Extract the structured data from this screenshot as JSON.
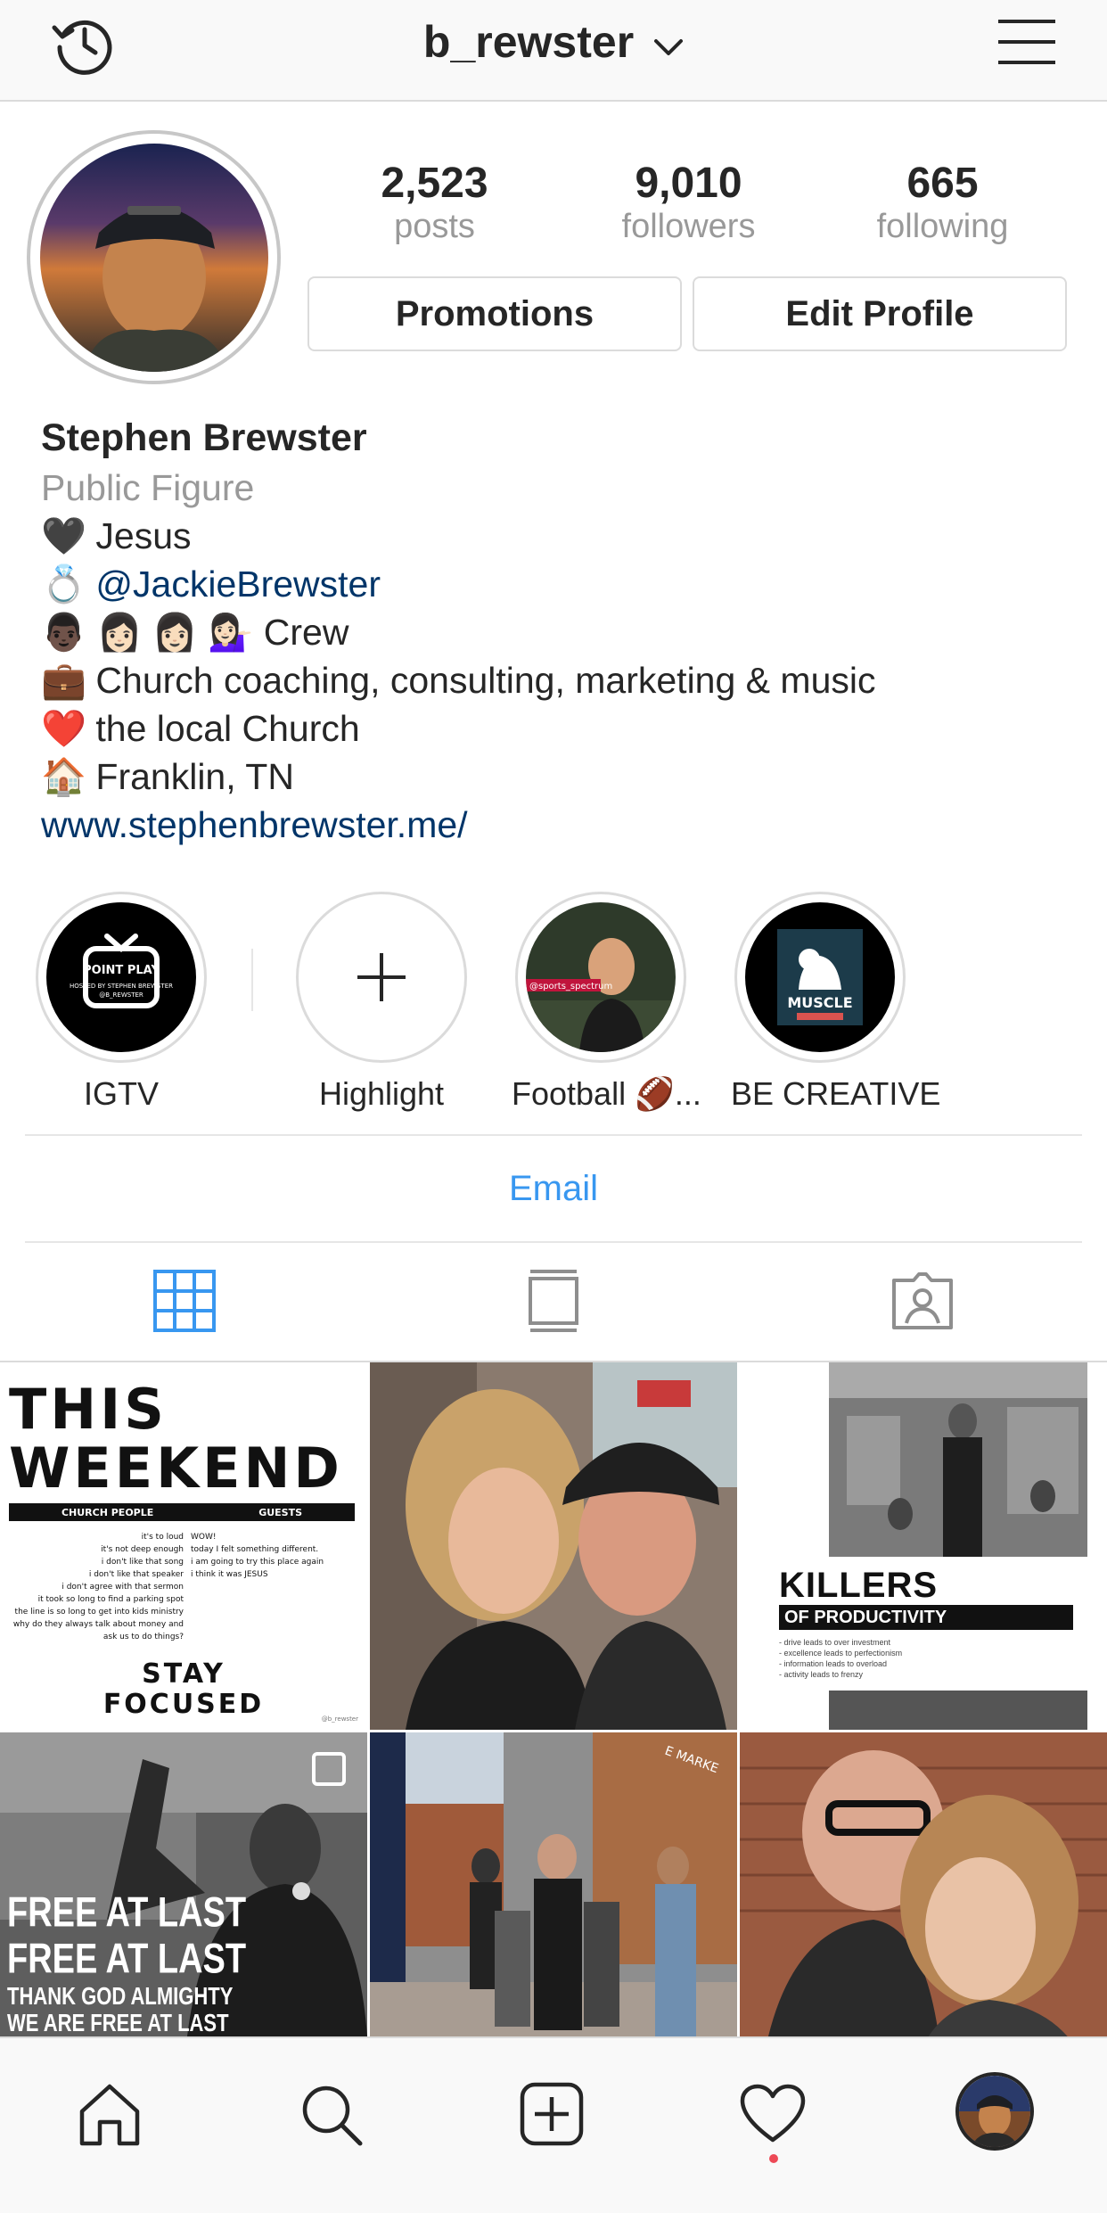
{
  "header": {
    "username": "b_rewster",
    "history_icon": "history-icon",
    "menu_icon": "hamburger-menu-icon"
  },
  "profile": {
    "stats": [
      {
        "value": "2,523",
        "label": "posts"
      },
      {
        "value": "9,010",
        "label": "followers"
      },
      {
        "value": "665",
        "label": "following"
      }
    ],
    "promotions_label": "Promotions",
    "edit_profile_label": "Edit Profile"
  },
  "bio": {
    "name": "Stephen  Brewster",
    "category": "Public Figure",
    "lines": [
      {
        "emoji": "🖤",
        "text": "Jesus"
      },
      {
        "emoji": "💍",
        "text": "@JackieBrewster"
      },
      {
        "emoji": "👨🏿 👩🏻 👩🏻 💁🏻‍♀️",
        "text": "Crew"
      },
      {
        "emoji": "💼",
        "text": "Church coaching, consulting, marketing & music"
      },
      {
        "emoji": "❤️",
        "text": "the local Church"
      },
      {
        "emoji": "🏠",
        "text": "Franklin, TN"
      }
    ],
    "website": "www.stephenbrewster.me/"
  },
  "highlights": [
    {
      "label": "IGTV",
      "cover_text": "POINT PLAY · HOSTED BY STEPHEN BREWSTER · @B_REWSTER"
    },
    {
      "label": "Highlight"
    },
    {
      "label": "Football 🏈...",
      "cover_text": "@sports_spectrum"
    },
    {
      "label": "BE CREATIVE",
      "cover_text": "MUSCLE"
    }
  ],
  "email_label": "Email",
  "tabs": [
    "grid-icon",
    "feed-list-icon",
    "tagged-icon"
  ],
  "posts": {
    "p1": {
      "line1": "THIS",
      "line2": "WEEKEND",
      "left_header": "CHURCH PEOPLE",
      "right_header": "GUESTS",
      "left_lines": [
        "it's to loud",
        "it's not deep enough",
        "i don't like that song",
        "i don't like that speaker",
        "i don't agree with that sermon",
        "it took so long to find a parking spot",
        "the line is so long to get into kids ministry",
        "why do they always talk about money and",
        "ask us to do things?"
      ],
      "right_lines": [
        "WOW!",
        "today I felt something different.",
        "i am going to try this place again",
        "i think it was JESUS"
      ],
      "footer1": "STAY",
      "footer2": "FOCUSED",
      "handle": "@b_rewster"
    },
    "p3": {
      "title": "KILLERS",
      "subtitle": "OF PRODUCTIVITY",
      "bullets": [
        "- drive leads to over investment",
        "- excellence leads to perfectionism",
        "- information leads to overload",
        "- activity leads to frenzy"
      ]
    },
    "p4": {
      "line1": "FREE AT LAST",
      "line2": "FREE AT LAST",
      "line3": "THANK GOD ALMIGHTY",
      "line4": "WE ARE FREE AT LAST"
    },
    "p5": {
      "store_sign": "E MARKE"
    }
  },
  "bottom_nav": [
    "home-icon",
    "search-icon",
    "new-post-icon",
    "activity-heart-icon",
    "profile-avatar"
  ],
  "colors": {
    "link": "#003569",
    "email": "#3897f0",
    "grid_active": "#3897f0",
    "secondary_text": "#999999",
    "notification": "#ed4956"
  }
}
